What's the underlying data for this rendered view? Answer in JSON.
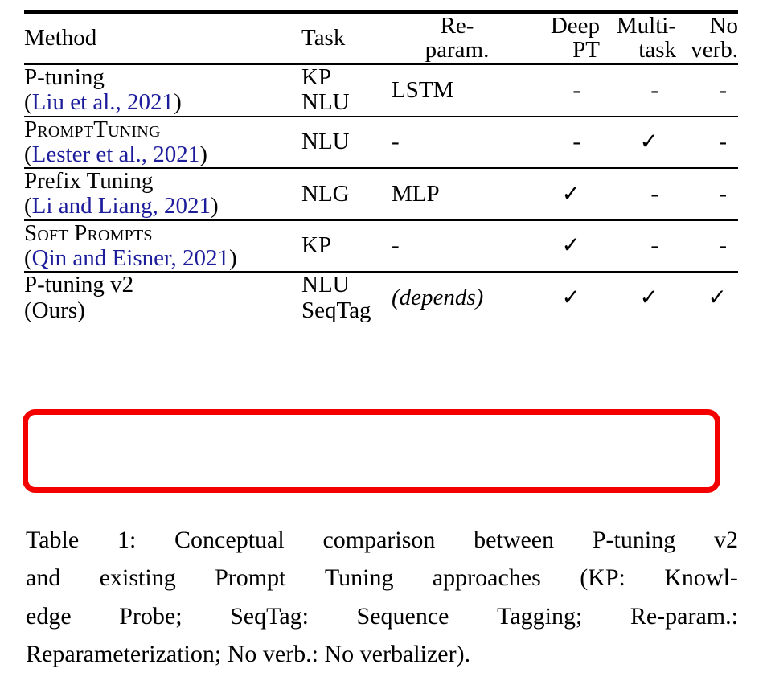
{
  "table": {
    "columns": [
      {
        "key": "method",
        "label": "Method",
        "lines": [
          "Method"
        ]
      },
      {
        "key": "task",
        "label": "Task",
        "lines": [
          "Task"
        ]
      },
      {
        "key": "reparam",
        "label": "Re-param.",
        "lines": [
          "Re-",
          "param."
        ]
      },
      {
        "key": "deep_pt",
        "label": "Deep PT",
        "lines": [
          "Deep",
          "PT"
        ]
      },
      {
        "key": "multitask",
        "label": "Multi-task",
        "lines": [
          "Multi-",
          "task"
        ]
      },
      {
        "key": "noverb",
        "label": "No verb.",
        "lines": [
          "No",
          "verb."
        ]
      }
    ],
    "rows": [
      {
        "method_name": "P-tuning",
        "method_style": "normal",
        "citation": "Liu et al., 2021",
        "task_lines": [
          "KP",
          "NLU"
        ],
        "reparam": "LSTM",
        "reparam_italic": false,
        "deep_pt": "-",
        "multitask": "-",
        "noverb": "-",
        "highlighted": false
      },
      {
        "method_name": "PromptTuning",
        "method_style": "smallcaps",
        "citation": "Lester et al., 2021",
        "task_lines": [
          "NLU"
        ],
        "reparam": "-",
        "reparam_italic": false,
        "deep_pt": "-",
        "multitask": "✓",
        "noverb": "-",
        "highlighted": false
      },
      {
        "method_name": "Prefix Tuning",
        "method_style": "normal",
        "citation": "Li and Liang, 2021",
        "task_lines": [
          "NLG"
        ],
        "reparam": "MLP",
        "reparam_italic": false,
        "deep_pt": "✓",
        "multitask": "-",
        "noverb": "-",
        "highlighted": false
      },
      {
        "method_name": "Soft Prompts",
        "method_style": "smallcaps",
        "citation": "Qin and Eisner, 2021",
        "task_lines": [
          "KP"
        ],
        "reparam": "-",
        "reparam_italic": false,
        "deep_pt": "✓",
        "multitask": "-",
        "noverb": "-",
        "highlighted": false
      },
      {
        "method_name": "P-tuning v2",
        "method_style": "normal",
        "citation": "Ours",
        "citation_plain": true,
        "task_lines": [
          "NLU",
          "SeqTag"
        ],
        "reparam": "(depends)",
        "reparam_italic": true,
        "deep_pt": "✓",
        "multitask": "✓",
        "noverb": "✓",
        "highlighted": true
      }
    ]
  },
  "caption": {
    "lines": [
      "Table 1: Conceptual comparison between P-tuning v2",
      "and existing Prompt Tuning approaches (KP: Knowl-",
      "edge Probe; SeqTag: Sequence Tagging; Re-param.:",
      "Reparameterization; No verb.: No verbalizer)."
    ],
    "full_text": "Table 1: Conceptual comparison between P-tuning v2 and existing Prompt Tuning approaches (KP: Knowledge Probe; SeqTag: Sequence Tagging; Re-param.: Reparameterization; No verb.: No verbalizer)."
  },
  "colors": {
    "citation_link": "#1d1d9c",
    "highlight_box": "#f40000",
    "text": "#000000",
    "background": "#ffffff"
  },
  "marks": {
    "check": "✓",
    "dash": "-"
  }
}
